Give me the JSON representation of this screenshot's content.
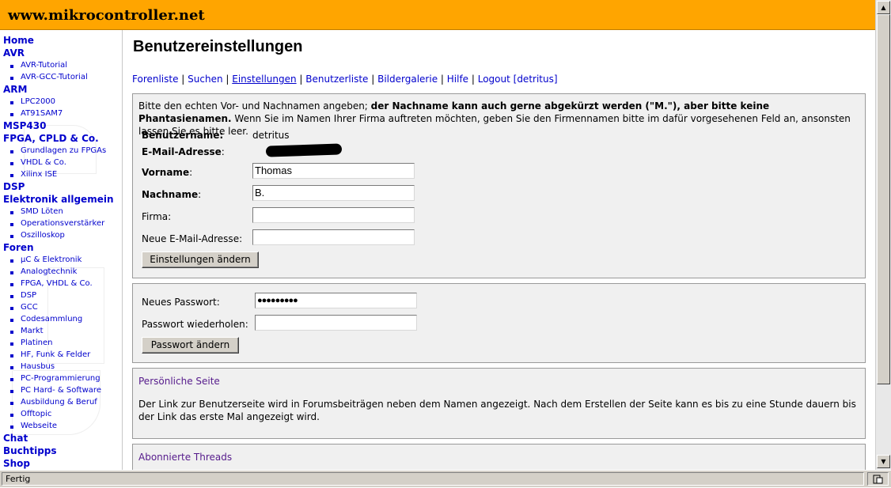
{
  "site": {
    "title": "www.mikrocontroller.net"
  },
  "sidebar": {
    "home": "Home",
    "avr": {
      "label": "AVR",
      "items": [
        "AVR-Tutorial",
        "AVR-GCC-Tutorial"
      ]
    },
    "arm": {
      "label": "ARM",
      "items": [
        "LPC2000",
        "AT91SAM7"
      ]
    },
    "msp430": "MSP430",
    "fpga": {
      "label": "FPGA, CPLD & Co.",
      "items": [
        "Grundlagen zu FPGAs",
        "VHDL & Co.",
        "Xilinx ISE"
      ]
    },
    "dsp": "DSP",
    "elektronik": {
      "label": "Elektronik allgemein",
      "items": [
        "SMD Löten",
        "Operationsverstärker",
        "Oszilloskop"
      ]
    },
    "foren": {
      "label": "Foren",
      "items": [
        "µC & Elektronik",
        "Analogtechnik",
        "FPGA, VHDL & Co.",
        "DSP",
        "GCC",
        "Codesammlung",
        "Markt",
        "Platinen",
        "HF, Funk & Felder",
        "Hausbus",
        "PC-Programmierung",
        "PC Hard- & Software",
        "Ausbildung & Beruf",
        "Offtopic",
        "Webseite"
      ]
    },
    "chat": "Chat",
    "buchtipps": "Buchtipps",
    "shop": "Shop"
  },
  "main": {
    "title": "Benutzereinstellungen",
    "nav": [
      "Forenliste",
      "Suchen",
      "Einstellungen",
      "Benutzerliste",
      "Bildergalerie",
      "Hilfe",
      "Logout [detritus]"
    ],
    "nav_separator": " | "
  },
  "profile": {
    "notice_normal_1": "Bitte den echten Vor- und Nachnamen angeben; ",
    "notice_bold": "der Nachname kann auch gerne abgekürzt werden (\"M.\"), aber bitte keine Phantasienamen.",
    "notice_normal_2": " Wenn Sie im Namen Ihrer Firma auftreten möchten, geben Sie den Firmennamen bitte im dafür vorgesehenen Feld an, ansonsten lassen Sie es bitte leer.",
    "username_label": "Benutzername:",
    "username_value": "detritus",
    "email_label": "E-Mail-Adresse",
    "email_colon": ":",
    "firstname_label": "Vorname",
    "firstname_colon": ":",
    "firstname_value": "Thomas",
    "lastname_label": "Nachname",
    "lastname_colon": ":",
    "lastname_value": "B.",
    "company_label": "Firma:",
    "company_value": "",
    "new_email_label": "Neue E-Mail-Adresse:",
    "new_email_value": "",
    "submit_label": "Einstellungen ändern"
  },
  "password": {
    "new_label": "Neues Passwort:",
    "new_value": "●●●●●●●●●",
    "repeat_label": "Passwort wiederholen:",
    "repeat_value": "",
    "submit_label": "Passwort ändern"
  },
  "personal_page": {
    "title": "Persönliche Seite",
    "text": "Der Link zur Benutzerseite wird in Forumsbeiträgen neben dem Namen angezeigt. Nach dem Erstellen der Seite kann es bis zu eine Stunde dauern bis der Link das erste Mal angezeigt wird."
  },
  "subscriptions": {
    "title": "Abonnierte Threads"
  },
  "statusbar": {
    "text": "Fertig"
  },
  "colors": {
    "header": "#ffa500",
    "link": "#0000cc",
    "visited": "#551a8b",
    "panel": "#f0f0f0"
  },
  "icons": {
    "scroll_up": "scroll-up-arrow",
    "scroll_down": "scroll-down-arrow",
    "status": "page-status-icon"
  }
}
